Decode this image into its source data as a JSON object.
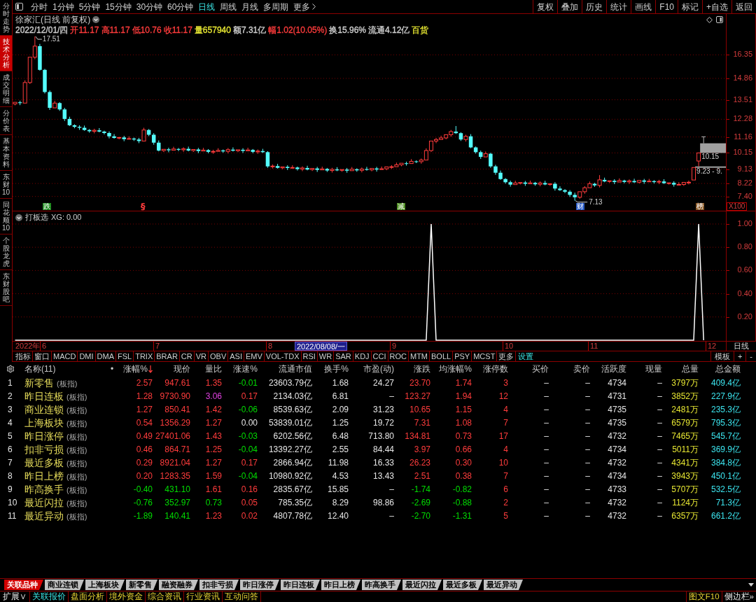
{
  "sidebar": {
    "tabs": [
      {
        "label": "分时走势",
        "selected": false
      },
      {
        "label": "技术分析",
        "selected": true
      },
      {
        "label": "成交明细",
        "selected": false
      },
      {
        "label": "分价表",
        "selected": false
      },
      {
        "label": "基本资料",
        "selected": false
      },
      {
        "label": "东财10",
        "selected": false
      },
      {
        "label": "同花顺10",
        "selected": false
      },
      {
        "label": "个股龙虎",
        "selected": false
      },
      {
        "label": "东财股吧",
        "selected": false
      }
    ]
  },
  "toolbar": {
    "periods": [
      {
        "label": "分时",
        "selected": false
      },
      {
        "label": "1分钟",
        "selected": false
      },
      {
        "label": "5分钟",
        "selected": false
      },
      {
        "label": "15分钟",
        "selected": false
      },
      {
        "label": "30分钟",
        "selected": false
      },
      {
        "label": "60分钟",
        "selected": false
      },
      {
        "label": "日线",
        "selected": true
      },
      {
        "label": "周线",
        "selected": false
      },
      {
        "label": "月线",
        "selected": false
      },
      {
        "label": "多周期",
        "selected": false
      }
    ],
    "more": "更多",
    "buttons": [
      "复权",
      "叠加",
      "历史",
      "统计",
      "画线",
      "F10",
      "标记",
      "+自选",
      "返回"
    ]
  },
  "stock": {
    "title": "徐家汇(日线 前复权)",
    "quote": [
      {
        "text": "2022/12/01/四",
        "color": "#d0d0d0"
      },
      {
        "text": "开11.17",
        "color": "#ff3c3c"
      },
      {
        "text": "高11.17",
        "color": "#ff3c3c"
      },
      {
        "text": "低10.76",
        "color": "#ff3c3c"
      },
      {
        "text": "收11.17",
        "color": "#ff3c3c"
      },
      {
        "text": "量657940",
        "color": "#e6e632"
      },
      {
        "text": "额7.31亿",
        "color": "#d0d0d0"
      },
      {
        "text": "幅1.02(10.05%)",
        "color": "#ff3c3c"
      },
      {
        "text": "换15.96%",
        "color": "#d0d0d0"
      },
      {
        "text": "流通4.12亿",
        "color": "#d0d0d0"
      },
      {
        "text": "百货",
        "color": "#e6e632"
      }
    ]
  },
  "price_chart": {
    "high_label": "17.51",
    "low_label": "7.13",
    "price_tags": [
      "10.15",
      "9.23 - 9."
    ],
    "events": [
      {
        "text": "跌",
        "kind": "tag",
        "color": "#1e8c1e"
      },
      {
        "text": "§",
        "kind": "text",
        "color": "#ff3c3c"
      },
      {
        "text": "减",
        "kind": "tag",
        "color": "#4b8c1e"
      },
      {
        "text": "财",
        "kind": "tag",
        "color": "#2a5cc8"
      },
      {
        "text": "榜",
        "kind": "tag",
        "color": "#8c5a28"
      }
    ],
    "scale": "X100",
    "chart_data": {
      "type": "candlestick",
      "grid": true,
      "categories": [
        null,
        null,
        null,
        null,
        null,
        null,
        null,
        null,
        null,
        null,
        null,
        null,
        null,
        null,
        null,
        null,
        null,
        null,
        null,
        null,
        null,
        null,
        null,
        null,
        null,
        null,
        null,
        null,
        null,
        null,
        null,
        null,
        null,
        null,
        null,
        null,
        null,
        null,
        null,
        null,
        null,
        null,
        null,
        null,
        null,
        null,
        null,
        null,
        null,
        null,
        null,
        null,
        null,
        null,
        null,
        null,
        null,
        null,
        null,
        null,
        null,
        null,
        null,
        null,
        null,
        null,
        null,
        null,
        null,
        null,
        null,
        null,
        null,
        null,
        null,
        null,
        null,
        null,
        null,
        null,
        null,
        null,
        null,
        null,
        null,
        null,
        null,
        null,
        null,
        null,
        null,
        null,
        null,
        null,
        null,
        null,
        null,
        null,
        null,
        null,
        null,
        null,
        null,
        null,
        null,
        null,
        null,
        null,
        null,
        null,
        null,
        null,
        null,
        null,
        null,
        null,
        null,
        null,
        null,
        null,
        null,
        null,
        null,
        null,
        null,
        null,
        null,
        null,
        null,
        null,
        null,
        null,
        null,
        null,
        null,
        null,
        null,
        null,
        null,
        null,
        null,
        null,
        null,
        null
      ],
      "ylim": [
        6.5,
        18.93
      ],
      "yticks": [
        {
          "value": 16.35,
          "label": "16.35"
        },
        {
          "value": 14.86,
          "label": "14.86"
        },
        {
          "value": 13.51,
          "label": "13.51"
        },
        {
          "value": 12.28,
          "label": "12.28"
        },
        {
          "value": 11.16,
          "label": "11.16"
        },
        {
          "value": 10.15,
          "label": "10.15"
        },
        {
          "value": 9.13,
          "label": "9.13"
        },
        {
          "value": 8.22,
          "label": "8.22"
        },
        {
          "value": 7.4,
          "label": "7.40"
        }
      ],
      "ohlc": [
        [
          13.25,
          13.41,
          13.16,
          13.35
        ],
        [
          13.35,
          13.45,
          13.17,
          13.3
        ],
        [
          13.3,
          14.74,
          13.25,
          14.6
        ],
        [
          14.6,
          16.26,
          14.51,
          16.2
        ],
        [
          16.2,
          17.51,
          16.07,
          16.9
        ],
        [
          16.9,
          17.04,
          15.35,
          15.4
        ],
        [
          15.4,
          15.46,
          13.91,
          14
        ],
        [
          14,
          14.1,
          12.87,
          13
        ],
        [
          13,
          13.44,
          12.95,
          13.3
        ],
        [
          13.3,
          13.36,
          12.81,
          12.9
        ],
        [
          12.9,
          13,
          12.17,
          12.3
        ],
        [
          12.3,
          12.44,
          11.85,
          11.9
        ],
        [
          11.9,
          11.96,
          11.71,
          11.8
        ],
        [
          11.8,
          11.9,
          11.61,
          11.74
        ],
        [
          11.74,
          11.88,
          11.55,
          11.6
        ],
        [
          11.6,
          11.66,
          11.43,
          11.52
        ],
        [
          11.52,
          11.68,
          11.39,
          11.58
        ],
        [
          11.58,
          11.72,
          11.45,
          11.5
        ],
        [
          11.5,
          11.56,
          11.32,
          11.41
        ],
        [
          11.41,
          11.51,
          11.07,
          11.2
        ],
        [
          11.2,
          11.34,
          11.05,
          11.1
        ],
        [
          11.1,
          11.19,
          11.01,
          11.13
        ],
        [
          11.13,
          11.23,
          10.89,
          11.02
        ],
        [
          11.02,
          11.2,
          10.97,
          11.06
        ],
        [
          11.06,
          11.12,
          10.91,
          11
        ],
        [
          11,
          11.1,
          10.77,
          10.9
        ],
        [
          10.9,
          11.74,
          10.85,
          11.6
        ],
        [
          11.6,
          11.66,
          11.21,
          11.3
        ],
        [
          11.3,
          11.4,
          10.67,
          10.8
        ],
        [
          10.8,
          10.94,
          10.25,
          10.3
        ],
        [
          10.3,
          10.44,
          10.21,
          10.38
        ],
        [
          10.38,
          10.48,
          10.19,
          10.32
        ],
        [
          10.32,
          10.54,
          10.27,
          10.4
        ],
        [
          10.4,
          10.46,
          10.26,
          10.35
        ],
        [
          10.35,
          10.51,
          10.22,
          10.41
        ],
        [
          10.41,
          10.55,
          10.25,
          10.3
        ],
        [
          10.3,
          10.43,
          10.21,
          10.37
        ],
        [
          10.37,
          10.47,
          10.14,
          10.27
        ],
        [
          10.27,
          10.47,
          10.22,
          10.33
        ],
        [
          10.33,
          10.39,
          10.13,
          10.22
        ],
        [
          10.22,
          10.35,
          10.09,
          10.25
        ],
        [
          10.25,
          10.45,
          10.2,
          10.31
        ],
        [
          10.31,
          10.37,
          10.16,
          10.25
        ],
        [
          10.25,
          10.46,
          10.12,
          10.36
        ],
        [
          10.36,
          10.5,
          10.24,
          10.29
        ],
        [
          10.29,
          10.41,
          10.2,
          10.35
        ],
        [
          10.35,
          10.45,
          10.15,
          10.28
        ],
        [
          10.28,
          10.48,
          10.23,
          10.34
        ],
        [
          10.34,
          10.4,
          10.13,
          10.22
        ],
        [
          10.22,
          10.37,
          10.09,
          10.27
        ],
        [
          10.27,
          10.41,
          10.15,
          10.2
        ],
        [
          10.2,
          10.26,
          9.21,
          9.3
        ],
        [
          9.3,
          9.42,
          9.17,
          9.32
        ],
        [
          9.32,
          9.46,
          9.16,
          9.21
        ],
        [
          9.21,
          9.33,
          9.12,
          9.27
        ],
        [
          9.27,
          9.37,
          9.07,
          9.2
        ],
        [
          9.2,
          9.37,
          9.15,
          9.23
        ],
        [
          9.23,
          9.29,
          9.04,
          9.13
        ],
        [
          9.13,
          9.3,
          9,
          9.2
        ],
        [
          9.2,
          9.34,
          9.05,
          9.1
        ],
        [
          9.1,
          9.23,
          9.01,
          9.17
        ],
        [
          9.17,
          9.27,
          8.95,
          9.08
        ],
        [
          9.08,
          9.28,
          9.03,
          9.14
        ],
        [
          9.14,
          9.2,
          8.95,
          9.04
        ],
        [
          9.04,
          9.21,
          8.91,
          9.11
        ],
        [
          9.11,
          9.25,
          9,
          9.05
        ],
        [
          9.05,
          9.16,
          8.96,
          9.1
        ],
        [
          9.1,
          9.2,
          8.9,
          9.03
        ],
        [
          9.03,
          9.26,
          8.98,
          9.12
        ],
        [
          9.12,
          9.18,
          8.96,
          9.05
        ],
        [
          9.05,
          9.23,
          8.92,
          9.13
        ],
        [
          9.13,
          9.27,
          9.03,
          9.08
        ],
        [
          9.08,
          9.23,
          8.99,
          9.17
        ],
        [
          9.17,
          9.27,
          8.97,
          9.1
        ],
        [
          9.1,
          9.29,
          9.05,
          9.15
        ],
        [
          9.15,
          9.33,
          9.06,
          9.27
        ],
        [
          9.27,
          9.38,
          9.14,
          9.28
        ],
        [
          9.28,
          9.54,
          9.23,
          9.4
        ],
        [
          9.4,
          9.56,
          9.31,
          9.5
        ],
        [
          9.5,
          9.6,
          9.35,
          9.48
        ],
        [
          9.48,
          9.76,
          9.43,
          9.62
        ],
        [
          9.62,
          9.68,
          9.51,
          9.6
        ],
        [
          9.6,
          9.8,
          9.47,
          9.7
        ],
        [
          9.7,
          10.44,
          9.65,
          10.3
        ],
        [
          10.3,
          10.96,
          10.21,
          10.9
        ],
        [
          10.9,
          11.1,
          10.77,
          11
        ],
        [
          11,
          11.24,
          10.95,
          11.1
        ],
        [
          11.1,
          11.36,
          11.01,
          11.3
        ],
        [
          11.3,
          11.6,
          11.17,
          11.5
        ],
        [
          11.5,
          11.85,
          11.35,
          11.4
        ],
        [
          11.4,
          11.46,
          10.91,
          11
        ],
        [
          11,
          11.3,
          10.87,
          11.2
        ],
        [
          11.2,
          11.34,
          10.45,
          10.5
        ],
        [
          10.5,
          10.56,
          10.11,
          10.2
        ],
        [
          10.2,
          10.3,
          9.77,
          9.9
        ],
        [
          9.9,
          10.24,
          9.85,
          10.1
        ],
        [
          10.1,
          10.16,
          9.21,
          9.3
        ],
        [
          9.3,
          9.4,
          8.77,
          8.9
        ],
        [
          8.9,
          9.04,
          8.45,
          8.5
        ],
        [
          8.5,
          8.56,
          8.21,
          8.3
        ],
        [
          8.3,
          8.4,
          8.02,
          8.15
        ],
        [
          8.15,
          8.39,
          8.1,
          8.25
        ],
        [
          8.25,
          8.34,
          8.16,
          8.28
        ],
        [
          8.28,
          8.38,
          8.07,
          8.2
        ],
        [
          8.2,
          8.4,
          8.15,
          8.26
        ],
        [
          8.26,
          8.32,
          8.08,
          8.17
        ],
        [
          8.17,
          8.35,
          8.04,
          8.25
        ],
        [
          8.25,
          8.39,
          8.11,
          8.16
        ],
        [
          8.16,
          8.26,
          8.07,
          8.2
        ],
        [
          8.2,
          8.3,
          7.77,
          7.9
        ],
        [
          7.9,
          8.04,
          7.75,
          7.8
        ],
        [
          7.8,
          7.86,
          7.61,
          7.7
        ],
        [
          7.7,
          7.8,
          7.37,
          7.5
        ],
        [
          7.5,
          7.64,
          7.13,
          7.35
        ],
        [
          7.35,
          7.76,
          7.26,
          7.7
        ],
        [
          7.7,
          8.05,
          7.57,
          7.95
        ],
        [
          7.95,
          8.34,
          7.9,
          8.2
        ],
        [
          8.2,
          8.26,
          8.01,
          8.1
        ],
        [
          8.1,
          8.75,
          7.97,
          8.45
        ],
        [
          8.45,
          8.59,
          8.3,
          8.35
        ],
        [
          8.35,
          8.45,
          8.26,
          8.39
        ],
        [
          8.39,
          8.49,
          8.18,
          8.31
        ],
        [
          8.31,
          8.54,
          8.26,
          8.4
        ],
        [
          8.4,
          8.46,
          8.23,
          8.32
        ],
        [
          8.32,
          8.48,
          8.19,
          8.38
        ],
        [
          8.38,
          8.52,
          8.25,
          8.3
        ],
        [
          8.3,
          8.47,
          8.21,
          8.41
        ],
        [
          8.41,
          8.51,
          8.2,
          8.33
        ],
        [
          8.33,
          8.51,
          8.28,
          8.37
        ],
        [
          8.37,
          8.43,
          8.22,
          8.31
        ],
        [
          8.31,
          8.45,
          8.18,
          8.35
        ],
        [
          8.35,
          8.49,
          8.19,
          8.24
        ],
        [
          8.24,
          8.32,
          8.15,
          8.26
        ],
        [
          8.26,
          8.36,
          8.02,
          8.15
        ],
        [
          8.15,
          8.3,
          8.1,
          8.16
        ],
        [
          8.16,
          8.35,
          8.07,
          8.29
        ],
        [
          8.29,
          8.4,
          8.16,
          8.3
        ],
        [
          8.44,
          9.23,
          8.4,
          9.23
        ],
        [
          9.64,
          10.15,
          9.3,
          10.15
        ],
        [
          11.17,
          11.17,
          10.76,
          11.17
        ],
        null,
        null,
        null,
        null
      ]
    }
  },
  "indicator": {
    "readout": "XG: 0.00",
    "chart_data": {
      "type": "line",
      "title": "打板选",
      "grid": true,
      "categories": [
        null,
        null,
        null,
        null,
        null,
        null,
        null,
        null,
        null,
        null,
        null,
        null,
        null,
        null,
        null,
        null,
        null,
        null,
        null,
        null,
        null,
        null,
        null,
        null,
        null,
        null,
        null,
        null,
        null,
        null,
        null,
        null,
        null,
        null,
        null,
        null,
        null,
        null,
        null,
        null,
        null,
        null,
        null,
        null,
        null,
        null,
        null,
        null,
        null,
        null,
        null,
        null,
        null,
        null,
        null,
        null,
        null,
        null,
        null,
        null,
        null,
        null,
        null,
        null,
        null,
        null,
        null,
        null,
        null,
        null,
        null,
        null,
        null,
        null,
        null,
        null,
        null,
        null,
        null,
        null,
        null,
        null,
        null,
        null,
        null,
        null,
        null,
        null,
        null,
        null,
        null,
        null,
        null,
        null,
        null,
        null,
        null,
        null,
        null,
        null,
        null,
        null,
        null,
        null,
        null,
        null,
        null,
        null,
        null,
        null,
        null,
        null,
        null,
        null,
        null,
        null,
        null,
        null,
        null,
        null,
        null,
        null,
        null,
        null,
        null,
        null,
        null,
        null,
        null,
        null,
        null,
        null,
        null,
        null,
        null,
        null,
        null,
        null,
        null,
        null,
        null,
        null,
        null,
        null
      ],
      "ylim": [
        0,
        1
      ],
      "yticks": [
        {
          "value": 0.2,
          "label": "0.20"
        },
        {
          "value": 0.4,
          "label": "0.40"
        },
        {
          "value": 0.6,
          "label": "0.60"
        },
        {
          "value": 0.8,
          "label": "0.80"
        },
        {
          "value": 1,
          "label": "1.00"
        }
      ],
      "series": [
        {
          "color": "#ffffff",
          "values": [
            0,
            0,
            0,
            0,
            0,
            0,
            0,
            0,
            0,
            0,
            0,
            0,
            0,
            0,
            0,
            0,
            0,
            0,
            0,
            0,
            0,
            0,
            0,
            0,
            0,
            0,
            0,
            0,
            0,
            0,
            0,
            0,
            0,
            0,
            0,
            0,
            0,
            0,
            0,
            0,
            0,
            0,
            0,
            0,
            0,
            0,
            0,
            0,
            0,
            0,
            0,
            0,
            0,
            0,
            0,
            0,
            0,
            0,
            0,
            0,
            0,
            0,
            0,
            0,
            0,
            0,
            0,
            0,
            0,
            0,
            0,
            0,
            0,
            0,
            0,
            0,
            0,
            0,
            0,
            0,
            0,
            0,
            0,
            0,
            1,
            0,
            0,
            0,
            0,
            0,
            0,
            0,
            0,
            0,
            0,
            0,
            0,
            0,
            0,
            0,
            0,
            0,
            0,
            0,
            0,
            0,
            0,
            0,
            0,
            0,
            0,
            0,
            0,
            0,
            0,
            0,
            0,
            0,
            0,
            0,
            0,
            0,
            0,
            0,
            0,
            0,
            0,
            0,
            0,
            0,
            0,
            0,
            0,
            0,
            0,
            0,
            0,
            0,
            1,
            0,
            null,
            null,
            null,
            null
          ]
        }
      ]
    }
  },
  "date_axis": {
    "year": "2022年",
    "months": [
      "6",
      "7",
      "8",
      "9",
      "10",
      "11",
      "12"
    ],
    "cursor": "2022/08/08/一",
    "period": "日线"
  },
  "indicator_tabs": {
    "tabs": [
      "指标",
      "窗口",
      "MACD",
      "DMI",
      "DMA",
      "FSL",
      "TRIX",
      "BRAR",
      "CR",
      "VR",
      "OBV",
      "ASI",
      "EMV",
      "VOL-TDX",
      "RSI",
      "WR",
      "SAR",
      "KDJ",
      "CCI",
      "ROC",
      "MTM",
      "BOLL",
      "PSY",
      "MCST",
      "更多"
    ],
    "settings": "设置",
    "buttons": [
      "模板",
      "+",
      "-"
    ]
  },
  "table": {
    "columns": [
      {
        "label": "名称(11)",
        "sorted": false
      },
      {
        "label": "•",
        "sorted": false
      },
      {
        "label": "涨幅%",
        "sorted": true
      },
      {
        "label": "现价",
        "sorted": false
      },
      {
        "label": "量比",
        "sorted": false
      },
      {
        "label": "涨速%",
        "sorted": false
      },
      {
        "label": "流通市值",
        "sorted": false
      },
      {
        "label": "换手%",
        "sorted": false
      },
      {
        "label": "市盈(动)",
        "sorted": false
      },
      {
        "label": "涨跌",
        "sorted": false
      },
      {
        "label": "均涨幅%",
        "sorted": false
      },
      {
        "label": "涨停数",
        "sorted": false
      },
      {
        "label": "买价",
        "sorted": false
      },
      {
        "label": "卖价",
        "sorted": false
      },
      {
        "label": "活跃度",
        "sorted": false
      },
      {
        "label": "现量",
        "sorted": false
      },
      {
        "label": "总量",
        "sorted": false
      },
      {
        "label": "总金额",
        "sorted": false
      }
    ],
    "rows": [
      {
        "no": "1",
        "cells": [
          {
            "text": "新零售",
            "tag": "(板指)"
          },
          "",
          {
            "text": "2.57",
            "color": "#ff3c3c"
          },
          {
            "text": "947.61",
            "color": "#ff3c3c"
          },
          {
            "text": "1.35",
            "color": "#ff3c3c"
          },
          {
            "text": "-0.01",
            "color": "#00dc00"
          },
          "23603.79亿",
          "1.68",
          "24.27",
          {
            "text": "23.70",
            "color": "#ff3c3c"
          },
          {
            "text": "1.74",
            "color": "#ff3c3c"
          },
          "3",
          "–",
          "–",
          "4734",
          "–",
          "3797万",
          "409.4亿"
        ]
      },
      {
        "no": "2",
        "cells": [
          {
            "text": "昨日连板",
            "tag": "(板指)"
          },
          "",
          {
            "text": "1.28",
            "color": "#ff3c3c"
          },
          {
            "text": "9730.90",
            "color": "#ff3c3c"
          },
          {
            "text": "3.06",
            "color": "#e040e0"
          },
          {
            "text": "0.17",
            "color": "#ff3c3c"
          },
          "2134.03亿",
          "6.81",
          "–",
          {
            "text": "123.27",
            "color": "#ff3c3c"
          },
          {
            "text": "1.94",
            "color": "#ff3c3c"
          },
          "12",
          "–",
          "–",
          "4731",
          "–",
          "3852万",
          "227.9亿"
        ]
      },
      {
        "no": "3",
        "cells": [
          {
            "text": "商业连锁",
            "tag": "(板指)"
          },
          "",
          {
            "text": "1.27",
            "color": "#ff3c3c"
          },
          {
            "text": "850.41",
            "color": "#ff3c3c"
          },
          {
            "text": "1.42",
            "color": "#ff3c3c"
          },
          {
            "text": "-0.06",
            "color": "#00dc00"
          },
          "8539.63亿",
          "2.09",
          "31.23",
          {
            "text": "10.65",
            "color": "#ff3c3c"
          },
          {
            "text": "1.15",
            "color": "#ff3c3c"
          },
          "4",
          "–",
          "–",
          "4735",
          "–",
          "2481万",
          "235.3亿"
        ]
      },
      {
        "no": "4",
        "cells": [
          {
            "text": "上海板块",
            "tag": "(板指)"
          },
          "",
          {
            "text": "0.54",
            "color": "#ff3c3c"
          },
          {
            "text": "1356.29",
            "color": "#ff3c3c"
          },
          {
            "text": "1.27",
            "color": "#ff3c3c"
          },
          {
            "text": "0.00",
            "color": "#e6e6e6"
          },
          "53839.01亿",
          "1.25",
          "19.72",
          {
            "text": "7.31",
            "color": "#ff3c3c"
          },
          {
            "text": "1.08",
            "color": "#ff3c3c"
          },
          "7",
          "–",
          "–",
          "4735",
          "–",
          "6579万",
          "795.3亿"
        ]
      },
      {
        "no": "5",
        "cells": [
          {
            "text": "昨日涨停",
            "tag": "(板指)"
          },
          "",
          {
            "text": "0.49",
            "color": "#ff3c3c"
          },
          {
            "text": "27401.06",
            "color": "#ff3c3c"
          },
          {
            "text": "1.43",
            "color": "#ff3c3c"
          },
          {
            "text": "-0.03",
            "color": "#00dc00"
          },
          "6202.56亿",
          "6.48",
          "713.80",
          {
            "text": "134.81",
            "color": "#ff3c3c"
          },
          {
            "text": "0.73",
            "color": "#ff3c3c"
          },
          "17",
          "–",
          "–",
          "4732",
          "–",
          "7465万",
          "545.7亿"
        ]
      },
      {
        "no": "6",
        "cells": [
          {
            "text": "扣非亏损",
            "tag": "(板指)"
          },
          "",
          {
            "text": "0.46",
            "color": "#ff3c3c"
          },
          {
            "text": "864.71",
            "color": "#ff3c3c"
          },
          {
            "text": "1.25",
            "color": "#ff3c3c"
          },
          {
            "text": "-0.04",
            "color": "#00dc00"
          },
          "13392.27亿",
          "2.55",
          "84.44",
          {
            "text": "3.97",
            "color": "#ff3c3c"
          },
          {
            "text": "0.66",
            "color": "#ff3c3c"
          },
          "4",
          "–",
          "–",
          "4734",
          "–",
          "5011万",
          "369.9亿"
        ]
      },
      {
        "no": "7",
        "cells": [
          {
            "text": "最近多板",
            "tag": "(板指)"
          },
          "",
          {
            "text": "0.29",
            "color": "#ff3c3c"
          },
          {
            "text": "8921.04",
            "color": "#ff3c3c"
          },
          {
            "text": "1.27",
            "color": "#ff3c3c"
          },
          {
            "text": "0.17",
            "color": "#ff3c3c"
          },
          "2866.94亿",
          "11.98",
          "16.33",
          {
            "text": "26.23",
            "color": "#ff3c3c"
          },
          {
            "text": "0.30",
            "color": "#ff3c3c"
          },
          "10",
          "–",
          "–",
          "4732",
          "–",
          "4341万",
          "384.8亿"
        ]
      },
      {
        "no": "8",
        "cells": [
          {
            "text": "昨日上榜",
            "tag": "(板指)"
          },
          "",
          {
            "text": "0.20",
            "color": "#ff3c3c"
          },
          {
            "text": "1283.35",
            "color": "#ff3c3c"
          },
          {
            "text": "1.59",
            "color": "#ff3c3c"
          },
          {
            "text": "-0.04",
            "color": "#00dc00"
          },
          "10980.92亿",
          "4.53",
          "13.43",
          {
            "text": "2.51",
            "color": "#ff3c3c"
          },
          {
            "text": "0.38",
            "color": "#ff3c3c"
          },
          "7",
          "–",
          "–",
          "4734",
          "–",
          "3943万",
          "450.1亿"
        ]
      },
      {
        "no": "9",
        "cells": [
          {
            "text": "昨高换手",
            "tag": "(板指)"
          },
          "",
          {
            "text": "-0.40",
            "color": "#00dc00"
          },
          {
            "text": "431.10",
            "color": "#00dc00"
          },
          {
            "text": "1.61",
            "color": "#ff3c3c"
          },
          {
            "text": "0.16",
            "color": "#ff3c3c"
          },
          "2835.67亿",
          "15.85",
          "–",
          {
            "text": "-1.74",
            "color": "#00dc00"
          },
          {
            "text": "-0.82",
            "color": "#00dc00"
          },
          "6",
          "–",
          "–",
          "4733",
          "–",
          "5707万",
          "532.5亿"
        ]
      },
      {
        "no": "10",
        "cells": [
          {
            "text": "最近闪拉",
            "tag": "(板指)"
          },
          "",
          {
            "text": "-0.76",
            "color": "#00dc00"
          },
          {
            "text": "352.97",
            "color": "#00dc00"
          },
          {
            "text": "0.73",
            "color": "#00dc00"
          },
          {
            "text": "0.05",
            "color": "#ff3c3c"
          },
          "785.35亿",
          "8.29",
          "98.86",
          {
            "text": "-2.69",
            "color": "#00dc00"
          },
          {
            "text": "-0.88",
            "color": "#00dc00"
          },
          "2",
          "–",
          "–",
          "4732",
          "–",
          "1124万",
          "71.3亿"
        ]
      },
      {
        "no": "11",
        "cells": [
          {
            "text": "最近异动",
            "tag": "(板指)"
          },
          "",
          {
            "text": "-1.89",
            "color": "#00dc00"
          },
          {
            "text": "140.41",
            "color": "#00dc00"
          },
          {
            "text": "1.23",
            "color": "#ff3c3c"
          },
          {
            "text": "0.02",
            "color": "#ff3c3c"
          },
          "4807.78亿",
          "12.40",
          "–",
          {
            "text": "-2.70",
            "color": "#00dc00"
          },
          {
            "text": "-1.31",
            "color": "#00dc00"
          },
          "5",
          "–",
          "–",
          "4732",
          "–",
          "6357万",
          "661.2亿"
        ]
      }
    ]
  },
  "bottom_tabs": {
    "tabs": [
      {
        "label": "关联品种",
        "selected": true
      },
      {
        "label": "商业连锁",
        "selected": false
      },
      {
        "label": "上海板块",
        "selected": false
      },
      {
        "label": "新零售",
        "selected": false
      },
      {
        "label": "融资融券",
        "selected": false
      },
      {
        "label": "扣非亏损",
        "selected": false
      },
      {
        "label": "昨日涨停",
        "selected": false
      },
      {
        "label": "昨日连板",
        "selected": false
      },
      {
        "label": "昨日上榜",
        "selected": false
      },
      {
        "label": "昨高换手",
        "selected": false
      },
      {
        "label": "最近闪拉",
        "selected": false
      },
      {
        "label": "最近多板",
        "selected": false
      },
      {
        "label": "最近异动",
        "selected": false
      }
    ]
  },
  "bottom_bar": {
    "expand": "扩展∨",
    "links": [
      {
        "label": "关联报价",
        "selected": true
      },
      {
        "label": "盘面分析",
        "selected": false
      },
      {
        "label": "境外资金",
        "selected": false
      },
      {
        "label": "综合资讯",
        "selected": false
      },
      {
        "label": "行业资讯",
        "selected": false
      },
      {
        "label": "互动问答",
        "selected": false
      }
    ],
    "f10": "图文F10",
    "sidebar": "侧边栏»"
  }
}
